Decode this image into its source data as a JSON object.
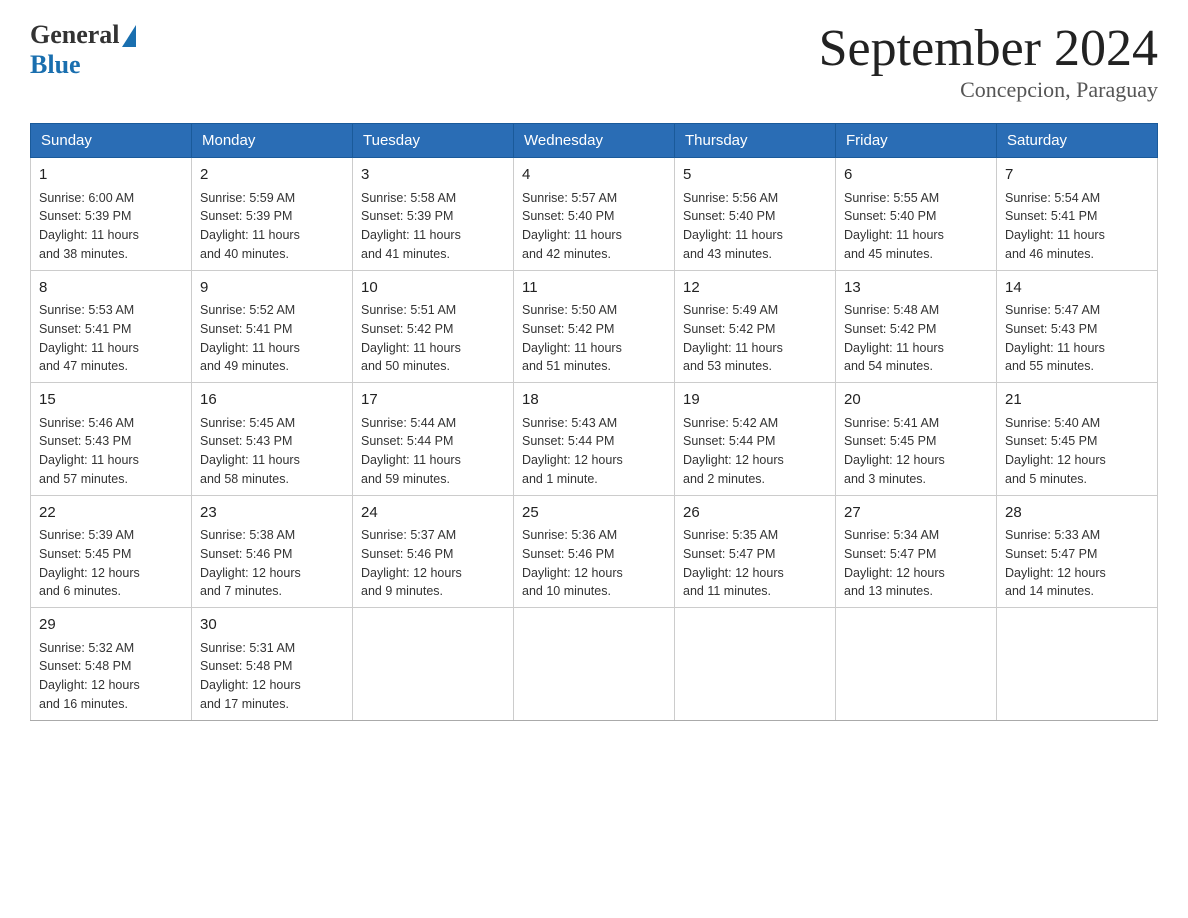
{
  "header": {
    "logo_general": "General",
    "logo_blue": "Blue",
    "month_title": "September 2024",
    "location": "Concepcion, Paraguay"
  },
  "days_of_week": [
    "Sunday",
    "Monday",
    "Tuesday",
    "Wednesday",
    "Thursday",
    "Friday",
    "Saturday"
  ],
  "weeks": [
    [
      {
        "day": "1",
        "info": "Sunrise: 6:00 AM\nSunset: 5:39 PM\nDaylight: 11 hours\nand 38 minutes."
      },
      {
        "day": "2",
        "info": "Sunrise: 5:59 AM\nSunset: 5:39 PM\nDaylight: 11 hours\nand 40 minutes."
      },
      {
        "day": "3",
        "info": "Sunrise: 5:58 AM\nSunset: 5:39 PM\nDaylight: 11 hours\nand 41 minutes."
      },
      {
        "day": "4",
        "info": "Sunrise: 5:57 AM\nSunset: 5:40 PM\nDaylight: 11 hours\nand 42 minutes."
      },
      {
        "day": "5",
        "info": "Sunrise: 5:56 AM\nSunset: 5:40 PM\nDaylight: 11 hours\nand 43 minutes."
      },
      {
        "day": "6",
        "info": "Sunrise: 5:55 AM\nSunset: 5:40 PM\nDaylight: 11 hours\nand 45 minutes."
      },
      {
        "day": "7",
        "info": "Sunrise: 5:54 AM\nSunset: 5:41 PM\nDaylight: 11 hours\nand 46 minutes."
      }
    ],
    [
      {
        "day": "8",
        "info": "Sunrise: 5:53 AM\nSunset: 5:41 PM\nDaylight: 11 hours\nand 47 minutes."
      },
      {
        "day": "9",
        "info": "Sunrise: 5:52 AM\nSunset: 5:41 PM\nDaylight: 11 hours\nand 49 minutes."
      },
      {
        "day": "10",
        "info": "Sunrise: 5:51 AM\nSunset: 5:42 PM\nDaylight: 11 hours\nand 50 minutes."
      },
      {
        "day": "11",
        "info": "Sunrise: 5:50 AM\nSunset: 5:42 PM\nDaylight: 11 hours\nand 51 minutes."
      },
      {
        "day": "12",
        "info": "Sunrise: 5:49 AM\nSunset: 5:42 PM\nDaylight: 11 hours\nand 53 minutes."
      },
      {
        "day": "13",
        "info": "Sunrise: 5:48 AM\nSunset: 5:42 PM\nDaylight: 11 hours\nand 54 minutes."
      },
      {
        "day": "14",
        "info": "Sunrise: 5:47 AM\nSunset: 5:43 PM\nDaylight: 11 hours\nand 55 minutes."
      }
    ],
    [
      {
        "day": "15",
        "info": "Sunrise: 5:46 AM\nSunset: 5:43 PM\nDaylight: 11 hours\nand 57 minutes."
      },
      {
        "day": "16",
        "info": "Sunrise: 5:45 AM\nSunset: 5:43 PM\nDaylight: 11 hours\nand 58 minutes."
      },
      {
        "day": "17",
        "info": "Sunrise: 5:44 AM\nSunset: 5:44 PM\nDaylight: 11 hours\nand 59 minutes."
      },
      {
        "day": "18",
        "info": "Sunrise: 5:43 AM\nSunset: 5:44 PM\nDaylight: 12 hours\nand 1 minute."
      },
      {
        "day": "19",
        "info": "Sunrise: 5:42 AM\nSunset: 5:44 PM\nDaylight: 12 hours\nand 2 minutes."
      },
      {
        "day": "20",
        "info": "Sunrise: 5:41 AM\nSunset: 5:45 PM\nDaylight: 12 hours\nand 3 minutes."
      },
      {
        "day": "21",
        "info": "Sunrise: 5:40 AM\nSunset: 5:45 PM\nDaylight: 12 hours\nand 5 minutes."
      }
    ],
    [
      {
        "day": "22",
        "info": "Sunrise: 5:39 AM\nSunset: 5:45 PM\nDaylight: 12 hours\nand 6 minutes."
      },
      {
        "day": "23",
        "info": "Sunrise: 5:38 AM\nSunset: 5:46 PM\nDaylight: 12 hours\nand 7 minutes."
      },
      {
        "day": "24",
        "info": "Sunrise: 5:37 AM\nSunset: 5:46 PM\nDaylight: 12 hours\nand 9 minutes."
      },
      {
        "day": "25",
        "info": "Sunrise: 5:36 AM\nSunset: 5:46 PM\nDaylight: 12 hours\nand 10 minutes."
      },
      {
        "day": "26",
        "info": "Sunrise: 5:35 AM\nSunset: 5:47 PM\nDaylight: 12 hours\nand 11 minutes."
      },
      {
        "day": "27",
        "info": "Sunrise: 5:34 AM\nSunset: 5:47 PM\nDaylight: 12 hours\nand 13 minutes."
      },
      {
        "day": "28",
        "info": "Sunrise: 5:33 AM\nSunset: 5:47 PM\nDaylight: 12 hours\nand 14 minutes."
      }
    ],
    [
      {
        "day": "29",
        "info": "Sunrise: 5:32 AM\nSunset: 5:48 PM\nDaylight: 12 hours\nand 16 minutes."
      },
      {
        "day": "30",
        "info": "Sunrise: 5:31 AM\nSunset: 5:48 PM\nDaylight: 12 hours\nand 17 minutes."
      },
      null,
      null,
      null,
      null,
      null
    ]
  ]
}
